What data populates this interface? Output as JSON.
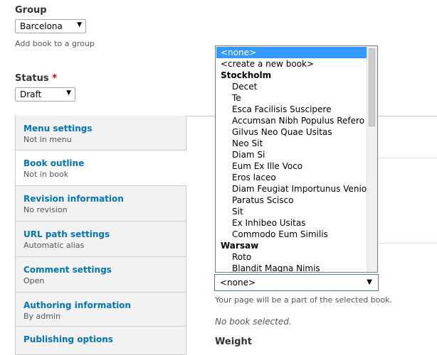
{
  "group": {
    "label": "Group",
    "selected": "Barcelona",
    "description": "Add book to a group"
  },
  "status": {
    "label": "Status",
    "required_mark": "*",
    "selected": "Draft"
  },
  "vertical_tabs": [
    {
      "title": "Menu settings",
      "summary": "Not in menu"
    },
    {
      "title": "Book outline",
      "summary": "Not in book"
    },
    {
      "title": "Revision information",
      "summary": "No revision"
    },
    {
      "title": "URL path settings",
      "summary": "Automatic alias"
    },
    {
      "title": "Comment settings",
      "summary": "Open"
    },
    {
      "title": "Authoring information",
      "summary": "By admin"
    },
    {
      "title": "Publishing options",
      "summary": ""
    }
  ],
  "book_dropdown": {
    "options": [
      {
        "text": "<none>",
        "kind": "option",
        "selected": true
      },
      {
        "text": "<create a new book>",
        "kind": "option"
      },
      {
        "text": "Stockholm",
        "kind": "group"
      },
      {
        "text": "Decet",
        "kind": "child"
      },
      {
        "text": "Te",
        "kind": "child"
      },
      {
        "text": "Esca Facilisis Suscipere",
        "kind": "child"
      },
      {
        "text": "Accumsan Nibh Populus Refero",
        "kind": "child"
      },
      {
        "text": "Gilvus Neo Quae Usitas",
        "kind": "child"
      },
      {
        "text": "Neo Sit",
        "kind": "child"
      },
      {
        "text": "Diam Si",
        "kind": "child"
      },
      {
        "text": "Eum Ex Ille Voco",
        "kind": "child"
      },
      {
        "text": "Eros laceo",
        "kind": "child"
      },
      {
        "text": "Diam Feugiat Importunus Venio",
        "kind": "child"
      },
      {
        "text": "Paratus Scisco",
        "kind": "child"
      },
      {
        "text": "Sit",
        "kind": "child"
      },
      {
        "text": "Ex Inhibeo Usitas",
        "kind": "child"
      },
      {
        "text": "Commodo Eum Similis",
        "kind": "child"
      },
      {
        "text": "Warsaw",
        "kind": "group"
      },
      {
        "text": "Roto",
        "kind": "child"
      },
      {
        "text": "Blandit Magna Nimis",
        "kind": "child"
      }
    ],
    "selected_value": "<none>"
  },
  "book_help": "Your page will be a part of the selected book.",
  "no_book": "No book selected.",
  "weight_label": "Weight"
}
